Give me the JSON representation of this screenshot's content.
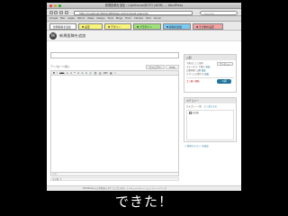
{
  "window": {
    "title": "新規投稿を追加 ‹ Lighthouse@GTO (AEMI) — WordPress"
  },
  "navbar": {
    "url": "http://localhost:8201/AEMI/wp-admin/post-new.php",
    "search_placeholder": "Google"
  },
  "bookmarks": [
    "Google",
    "Mac",
    "Apple",
    "Yahoo!",
    "News",
    "Design",
    "Tools",
    "Blogs",
    "Flickr",
    "Camera",
    "Tech",
    "Social"
  ],
  "tabs": {
    "items": [
      {
        "label": "新規投稿を追加",
        "color": "#ffffff"
      },
      {
        "label": "▼ 設定",
        "color": "#f9f57a"
      },
      {
        "label": "▼ デザイン",
        "color": "#f9f57a"
      },
      {
        "label": "▼ プラグイン",
        "color": "#9ee27a"
      },
      {
        "label": "▼ 投稿の追加",
        "color": "#7ccaf2"
      },
      {
        "label": "▼ その他の設定",
        "color": "#f2a3a3"
      }
    ]
  },
  "header": {
    "logo": "W",
    "title": "新規投稿を追加"
  },
  "editor": {
    "upload_label": "アップロード/挿入",
    "mode_visual": "ビジュアル",
    "mode_html": "HTML",
    "toolbar": [
      "B",
      "I",
      "ABC",
      "≡",
      "≡",
      "❝",
      "≡",
      "≡",
      "≡",
      "🔗",
      "⛓",
      "▤",
      "ABC",
      "▦",
      "⛶"
    ],
    "path_label": "パス:",
    "wordcount": "文字数: 0"
  },
  "publish_box": {
    "heading": "公開",
    "save_draft": "下書きとして保存",
    "preview": "プレビュー",
    "status_label": "ステータス: 下書き",
    "status_edit": "編集",
    "visibility_label": "公開状態: 公開",
    "visibility_edit": "編集",
    "schedule_label": "すぐに公開する",
    "schedule_edit": "編集",
    "trash_link": "ゴミ箱へ移動",
    "publish_button": "公開"
  },
  "category_box": {
    "heading": "カテゴリー",
    "tab_all": "カテゴリー一覧",
    "tab_popular": "よく使うもの",
    "items": [
      "未分類"
    ],
    "add_link": "+ 新規カテゴリーを追加"
  },
  "statusbar": {
    "text": "WordPress のご利用ありがとうございます。| ドキュメンテーション | フィードバック"
  },
  "caption": "できた！"
}
